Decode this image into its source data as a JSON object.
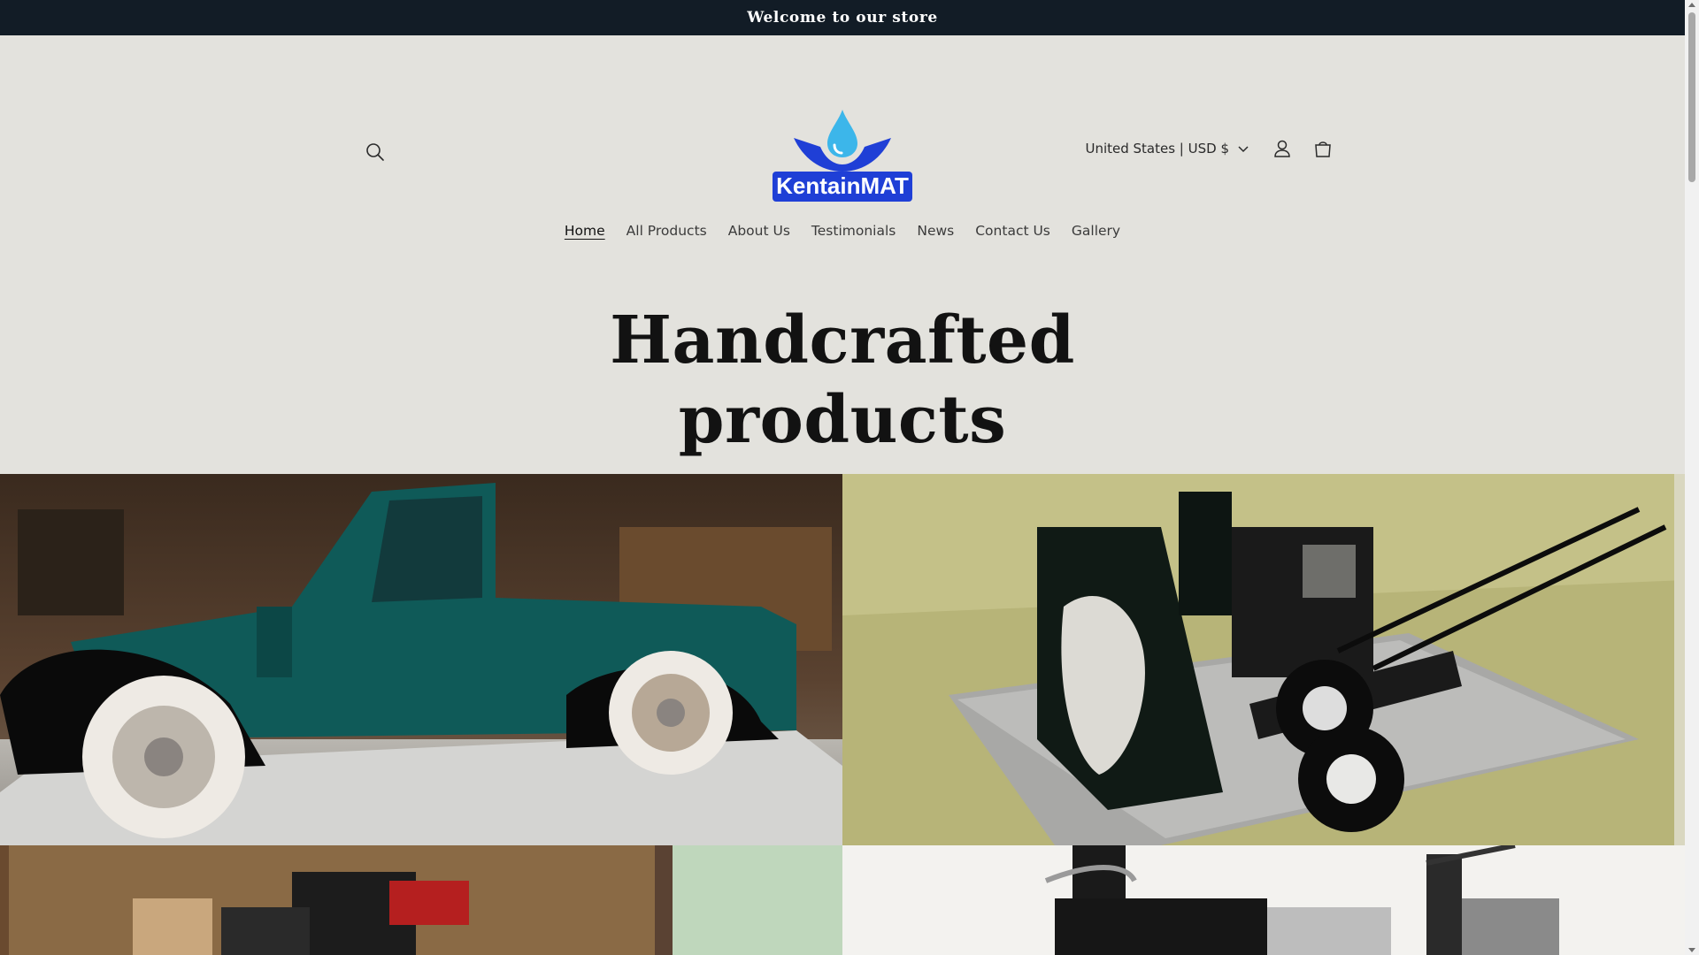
{
  "announcement": {
    "text": "Welcome to our store"
  },
  "header": {
    "logo_text": "KentainMAT",
    "country_selector": "United States | USD $",
    "icons": {
      "search": "search-icon",
      "account": "account-icon",
      "cart": "cart-icon",
      "chevron": "chevron-down-icon"
    }
  },
  "nav": {
    "items": [
      {
        "label": "Home",
        "active": true
      },
      {
        "label": "All Products"
      },
      {
        "label": "About Us"
      },
      {
        "label": "Testimonials"
      },
      {
        "label": "News"
      },
      {
        "label": "Contact Us"
      },
      {
        "label": "Gallery"
      }
    ]
  },
  "hero": {
    "title_line1": "Handcrafted",
    "title_line2": "products"
  },
  "gallery": {
    "tiles": [
      {
        "subject": "vintage teal pickup truck on garage mat"
      },
      {
        "subject": "snow blower on grey mat"
      },
      {
        "subject": "ride-on mower in shed"
      },
      {
        "subject": "motorcycle on white background"
      }
    ]
  },
  "colors": {
    "page_bg": "#e3e2dd",
    "announcement_bg": "#121c26",
    "logo_blue": "#1f3fd6",
    "logo_water": "#3cb6ea"
  }
}
